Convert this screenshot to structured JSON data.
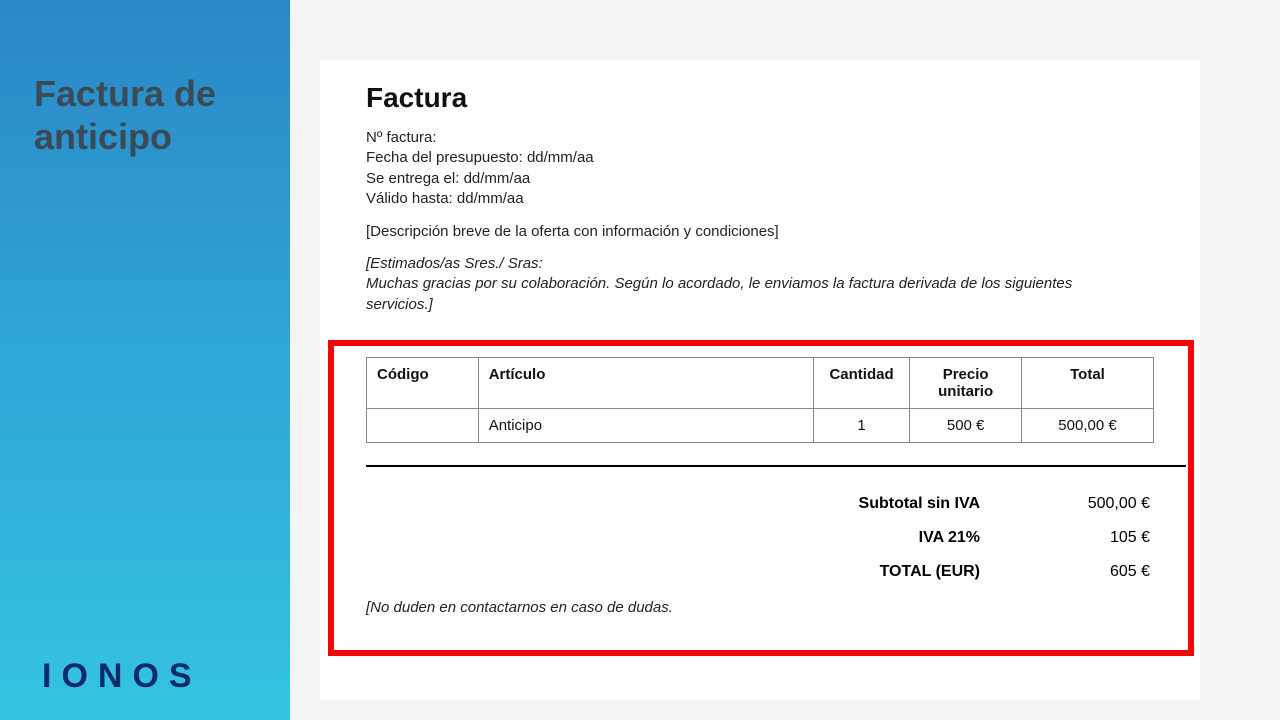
{
  "sidebar": {
    "title": "Factura de anticipo",
    "brand": "IONOS"
  },
  "doc": {
    "heading": "Factura",
    "meta": {
      "invoice_no_label": "Nº factura:",
      "invoice_no_value": "",
      "budget_date_label": "Fecha del presupuesto:",
      "budget_date_value": "dd/mm/aa",
      "delivered_label": "Se entrega el:",
      "delivered_value": "dd/mm/aa",
      "valid_until_label": "Válido hasta:",
      "valid_until_value": "dd/mm/aa"
    },
    "description_placeholder": "[Descripción breve de la oferta con información y condiciones]",
    "letter": "[Estimados/as Sres./ Sras:\nMuchas gracias por su colaboración. Según lo acordado, le enviamos la factura derivada de los siguientes servicios.]",
    "table": {
      "headers": {
        "code": "Código",
        "article": "Artículo",
        "qty": "Cantidad",
        "unit_price": "Precio\nunitario",
        "total": "Total"
      },
      "row": {
        "code": "",
        "article": "Anticipo",
        "qty": "1",
        "unit_price": "500 €",
        "total": "500,00 €"
      }
    },
    "totals": {
      "subtotal_label": "Subtotal sin IVA",
      "subtotal_value": "500,00 €",
      "vat_label": "IVA 21%",
      "vat_value": "105 €",
      "grand_label": "TOTAL (EUR)",
      "grand_value": "605 €"
    },
    "footnote": "[No duden en contactarnos en caso de dudas."
  }
}
